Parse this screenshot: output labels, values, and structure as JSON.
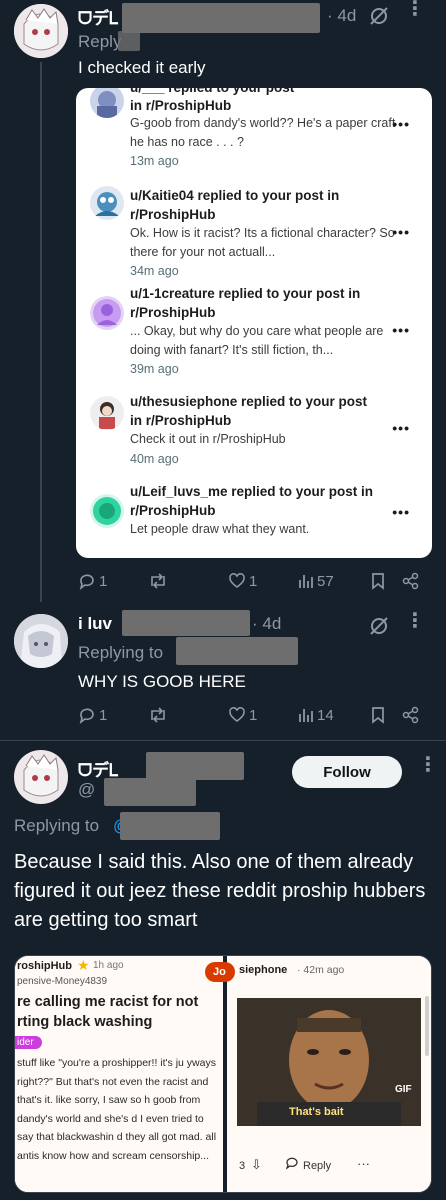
{
  "tweet1": {
    "display_name": "ᗜデᏞ",
    "time": "· 4d",
    "reply_prefix": "Reply",
    "text": "I checked it early",
    "actions": {
      "replies": "1",
      "retweets": "",
      "likes": "1",
      "views": "57"
    }
  },
  "notifications": [
    {
      "title": "in r/ProshipHub",
      "title_cut": "u/___ replied to your post",
      "body": "G-goob from dandy's world?? He's a paper craft he has no race . . . ?",
      "time": "13m ago"
    },
    {
      "title": "u/Kaitie04 replied to your post in r/ProshipHub",
      "body": "Ok. How is it racist? Its a fictional character? So there for your not actuall...",
      "time": "34m ago"
    },
    {
      "title": "u/1-1creature replied to your post in r/ProshipHub",
      "body": "... Okay, but why do you care what people are doing with fanart? It's still fiction, th...",
      "time": "39m ago"
    },
    {
      "title": "u/thesusiephone replied to your post in r/ProshipHub",
      "body": "Check it out in r/ProshipHub",
      "time": "40m ago"
    },
    {
      "title": "u/Leif_luvs_me replied to your post in r/ProshipHub",
      "body": "Let people draw what they want.",
      "time": ""
    }
  ],
  "more_label": "•••",
  "tweet2": {
    "display_name": "i luv",
    "time": "· 4d",
    "reply_prefix": "Replying to",
    "text": "WHY IS GOOB HERE",
    "actions": {
      "replies": "1",
      "retweets": "",
      "likes": "1",
      "views": "14"
    }
  },
  "tweet3": {
    "display_name": "ᗜデᏞ",
    "handle_prefix": "@",
    "follow_label": "Follow",
    "reply_prefix": "Replying to",
    "text": "Because I said this. Also one of them already figured it out jeez these reddit proship hubbers are getting too smart"
  },
  "media": {
    "left": {
      "sub": "roshipHub",
      "time": "1h ago",
      "user": "pensive-Money4839",
      "title": "re calling me racist for not rting black washing",
      "flair": "ider",
      "body": "stuff like \"you're a proshipper!! it's ju yways right??\" But that's not even the racist and that's it. like sorry, I saw so h goob from dandy's world and she's d I even tried to say that blackwashin d they all got mad. all antis know how and scream censorship..."
    },
    "right": {
      "badge": "Jo",
      "user": "siephone",
      "time": "· 42m ago",
      "gif_caption": "That's bait",
      "gif_label": "GIF",
      "vote_count": "3",
      "reply_label": "Reply",
      "more": "···"
    }
  },
  "colors": {
    "bg": "#15202b",
    "text": "#e7e9ea",
    "muted": "#8b98a5",
    "accent": "#1d9bf0"
  }
}
